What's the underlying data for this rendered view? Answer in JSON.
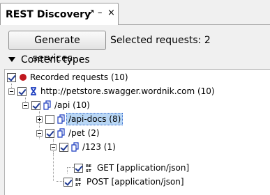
{
  "panel": {
    "title": "REST Discovery",
    "pin_glyph": "↗",
    "minimize_glyph": "–",
    "close_glyph": "×"
  },
  "toolbar": {
    "generate_label": "Generate services...",
    "selected_label": "Selected requests: 2"
  },
  "section": {
    "title": "Content types"
  },
  "tree": {
    "root": {
      "label": "Recorded requests (10)"
    },
    "host": {
      "label": "http://petstore.swagger.wordnik.com (10)"
    },
    "api": {
      "label": "/api (10)"
    },
    "api_docs": {
      "label": "/api-docs (8)"
    },
    "pet": {
      "label": "/pet (2)"
    },
    "pet_123": {
      "label": "/123 (1)"
    },
    "get_req": {
      "label": "GET [application/json]"
    },
    "post_req": {
      "label": "POST [application/json]"
    }
  },
  "colors": {
    "record_dot": "#c0181f",
    "host_icon": "#1a3bbf",
    "selection": "#b9d7f5"
  }
}
